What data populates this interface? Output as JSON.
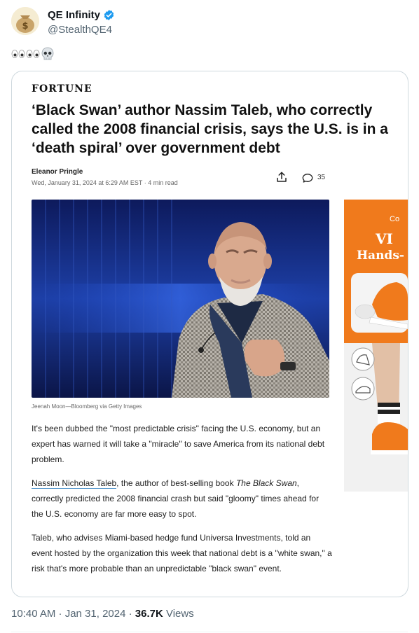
{
  "author": {
    "display_name": "QE Infinity",
    "handle": "@StealthQE4",
    "verified_color": "#1d9bf0"
  },
  "tweet": {
    "text_icons": [
      "eyes-emoji",
      "eyes-emoji",
      "skull-emoji"
    ]
  },
  "article": {
    "outlet": "FORTUNE",
    "headline": "‘Black Swan’ author Nassim Taleb, who correctly called the 2008 financial crisis, says the U.S. is in a ‘death spiral’ over government debt",
    "byline": "Eleanor Pringle",
    "dateline": "Wed, January 31, 2024 at 6:29 AM EST · 4 min read",
    "comment_count": "35",
    "photo_caption": "Jeenah Moon—Bloomberg via Getty Images",
    "para1": "It's been dubbed the \"most predictable crisis\" facing the U.S. economy, but an expert has warned it will take a \"miracle\" to save America from its national debt problem.",
    "para2_link": "Nassim Nicholas Taleb",
    "para2_a": ", the author of best-selling book ",
    "para2_book": "The Black Swan",
    "para2_b": ", correctly predicted the 2008 financial crash but said \"gloomy\" times ahead for the U.S. economy are far more easy to spot.",
    "para3": "Taleb, who advises Miami-based hedge fund Universa Investments, told an event hosted by the organization this week that national debt is a \"white swan,\" a risk that's more probable than an unpredictable \"black swan\" event.",
    "ad_text1": "Co",
    "ad_text2": "VI",
    "ad_text3": "Hands-"
  },
  "meta": {
    "time_date": "10:40 AM · Jan 31, 2024 · ",
    "views_count": "36.7K",
    "views_label": " Views"
  }
}
